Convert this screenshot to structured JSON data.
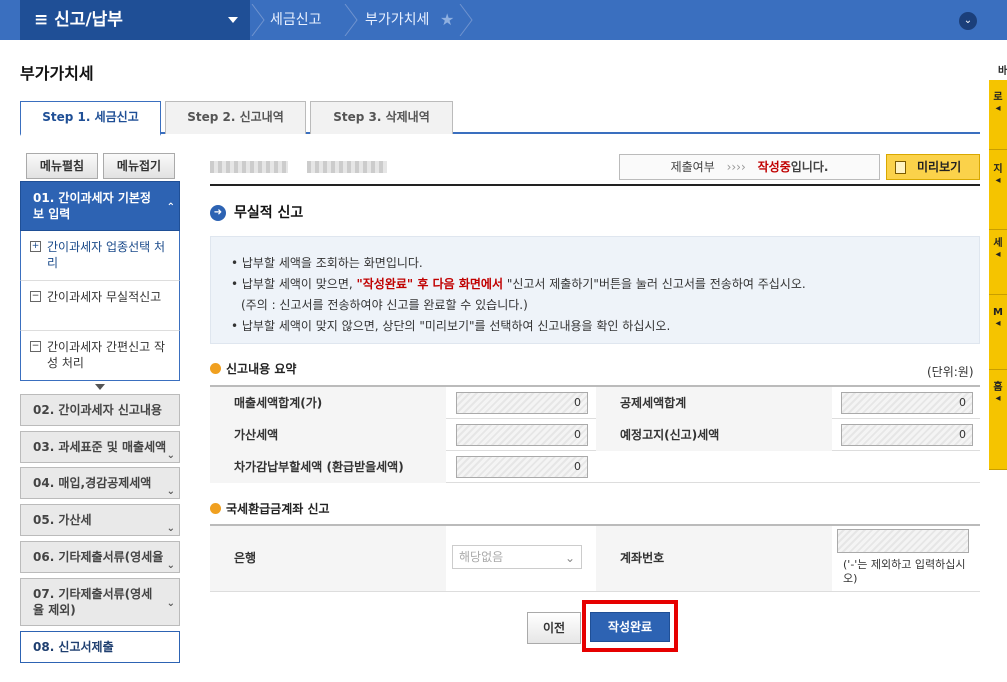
{
  "topbar": {
    "menu_title": "≡  신고/납부",
    "crumb1": "세금신고",
    "crumb2": "부가가치세"
  },
  "page_title": "부가가치세",
  "tabs": [
    {
      "label": "Step 1. 세금신고"
    },
    {
      "label": "Step 2. 신고내역"
    },
    {
      "label": "Step 3. 삭제내역"
    }
  ],
  "sidebar": {
    "expand_all": "메뉴펼침",
    "collapse_all": "메뉴접기",
    "step01": "01. 간이과세자 기본정보 입력",
    "subs": [
      {
        "label": "간이과세자 업종선택 처리",
        "icon": "+"
      },
      {
        "label": "간이과세자 무실적신고",
        "icon": "−"
      },
      {
        "label": "간이과세자 간편신고 작성 처리",
        "icon": "−"
      }
    ],
    "steps": [
      {
        "label": "02. 간이과세자 신고내용"
      },
      {
        "label": "03. 과세표준 및 매출세액"
      },
      {
        "label": "04. 매입,경감공제세액"
      },
      {
        "label": "05. 가산세"
      },
      {
        "label": "06. 기타제출서류(영세율"
      },
      {
        "label": "07. 기타제출서류(영세율 제외)"
      }
    ],
    "step08": "08. 신고서제출"
  },
  "status": {
    "label": "제출여부",
    "arrows": "››››",
    "state_red": "작성중",
    "state_suffix": "입니다."
  },
  "preview_btn": "미리보기",
  "section_title": "무실적 신고",
  "info": {
    "line1": "• 납부할 세액을 조회하는 화면입니다.",
    "line2_pre": "• 납부할 세액이 맞으면, ",
    "line2_hl": "\"작성완료\" 후 다음 화면에서",
    "line2_post": " \"신고서 제출하기\"버튼을 눌러 신고서를 전송하여 주십시오.",
    "line3": "(주의 : 신고서를 전송하여야 신고를 완료할 수 있습니다.)",
    "line4": "• 납부할 세액이 맞지 않으면, 상단의 \"미리보기\"를 선택하여 신고내용을 확인 하십시오."
  },
  "summary": {
    "title": "신고내용 요약",
    "unit": "(단위:원)",
    "rows": [
      {
        "l1": "매출세액합계(가)",
        "v1": "0",
        "l2": "공제세액합계",
        "v2": "0"
      },
      {
        "l1": "가산세액",
        "v1": "0",
        "l2": "예정고지(신고)세액",
        "v2": "0"
      },
      {
        "l1": "차가감납부할세액 (환급받을세액)",
        "v1": "0"
      }
    ]
  },
  "refund": {
    "title": "국세환급금계좌 신고",
    "bank_label": "은행",
    "bank_placeholder": "해당없음",
    "account_label": "계좌번호",
    "account_note": "('-'는 제외하고 입력하십시오)"
  },
  "buttons": {
    "prev": "이전",
    "done": "작성완료"
  },
  "right_strip": [
    "바",
    "로",
    "지",
    "세",
    "M",
    "홈"
  ]
}
